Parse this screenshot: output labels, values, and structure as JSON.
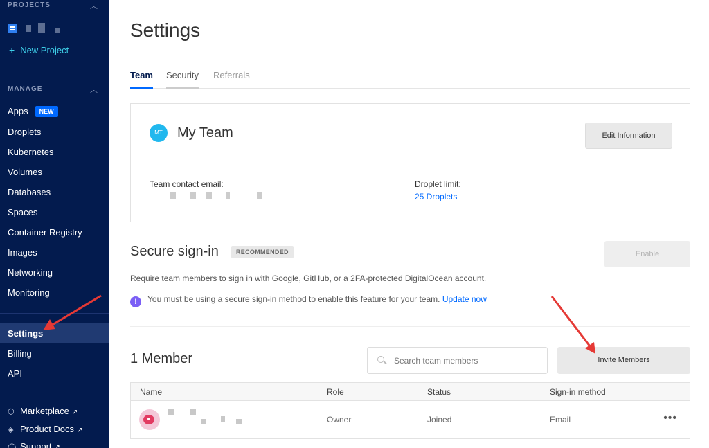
{
  "sidebar": {
    "projects_heading": "PROJECTS",
    "new_project_label": "New Project",
    "manage_heading": "MANAGE",
    "items": [
      {
        "label": "Apps",
        "badge": "NEW"
      },
      {
        "label": "Droplets"
      },
      {
        "label": "Kubernetes"
      },
      {
        "label": "Volumes"
      },
      {
        "label": "Databases"
      },
      {
        "label": "Spaces"
      },
      {
        "label": "Container Registry"
      },
      {
        "label": "Images"
      },
      {
        "label": "Networking"
      },
      {
        "label": "Monitoring"
      }
    ],
    "account_items": [
      {
        "label": "Settings",
        "active": true
      },
      {
        "label": "Billing"
      },
      {
        "label": "API"
      }
    ],
    "external_items": [
      {
        "label": "Marketplace",
        "icon": "cube-icon"
      },
      {
        "label": "Product Docs",
        "icon": "layers-icon"
      },
      {
        "label": "Support",
        "icon": "help-icon"
      }
    ],
    "colors": {
      "background": "#031b4e",
      "accent": "#3ed0e9",
      "badge": "#0069ff"
    }
  },
  "main": {
    "title": "Settings",
    "tabs": [
      {
        "label": "Team",
        "active": true
      },
      {
        "label": "Security"
      },
      {
        "label": "Referrals"
      }
    ],
    "team_card": {
      "avatar_initials": "MT",
      "team_name": "My Team",
      "edit_button": "Edit Information",
      "contact_email_label": "Team contact email:",
      "droplet_limit_label": "Droplet limit:",
      "droplet_limit_value": "25 Droplets"
    },
    "secure_signin": {
      "title": "Secure sign-in",
      "badge": "RECOMMENDED",
      "enable_button": "Enable",
      "description": "Require team members to sign in with Google, GitHub, or a 2FA-protected DigitalOcean account.",
      "notice_text": "You must be using a secure sign-in method to enable this feature for your team.",
      "notice_link": "Update now"
    },
    "members": {
      "count_label": "1 Member",
      "search_placeholder": "Search team members",
      "invite_button": "Invite Members",
      "columns": [
        "Name",
        "Role",
        "Status",
        "Sign-in method"
      ],
      "rows": [
        {
          "role": "Owner",
          "status": "Joined",
          "signin_method": "Email"
        }
      ]
    }
  }
}
